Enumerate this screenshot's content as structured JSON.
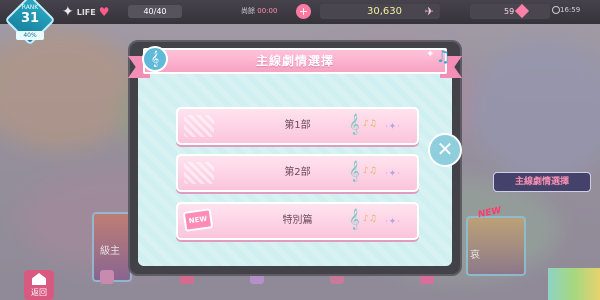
{
  "status_bar": {
    "rank_label": "RANK",
    "rank_value": "31",
    "rank_percent": "40%",
    "life_label": "LIFE",
    "life_value": "40/40",
    "timer_label": "尚餘",
    "timer_value": "00:00",
    "coins": "30,630",
    "gems": "59",
    "clock": "16:59"
  },
  "dialog": {
    "title": "主線劇情選擇",
    "items": [
      {
        "label": "第1部"
      },
      {
        "label": "第2部"
      },
      {
        "label": "特別篇",
        "badge": "NEW"
      }
    ],
    "close_symbol": "✕"
  },
  "side": {
    "banner": "主線劇情選擇",
    "new_tag": "NEW",
    "left_card_text": "級主",
    "right_card_text": "哀"
  },
  "bottom_nav": {
    "home_label": "返回"
  },
  "colors": {
    "accent_pink": "#f7a2c3",
    "panel_cyan": "#cfeff0",
    "frame_dark": "#444249"
  }
}
